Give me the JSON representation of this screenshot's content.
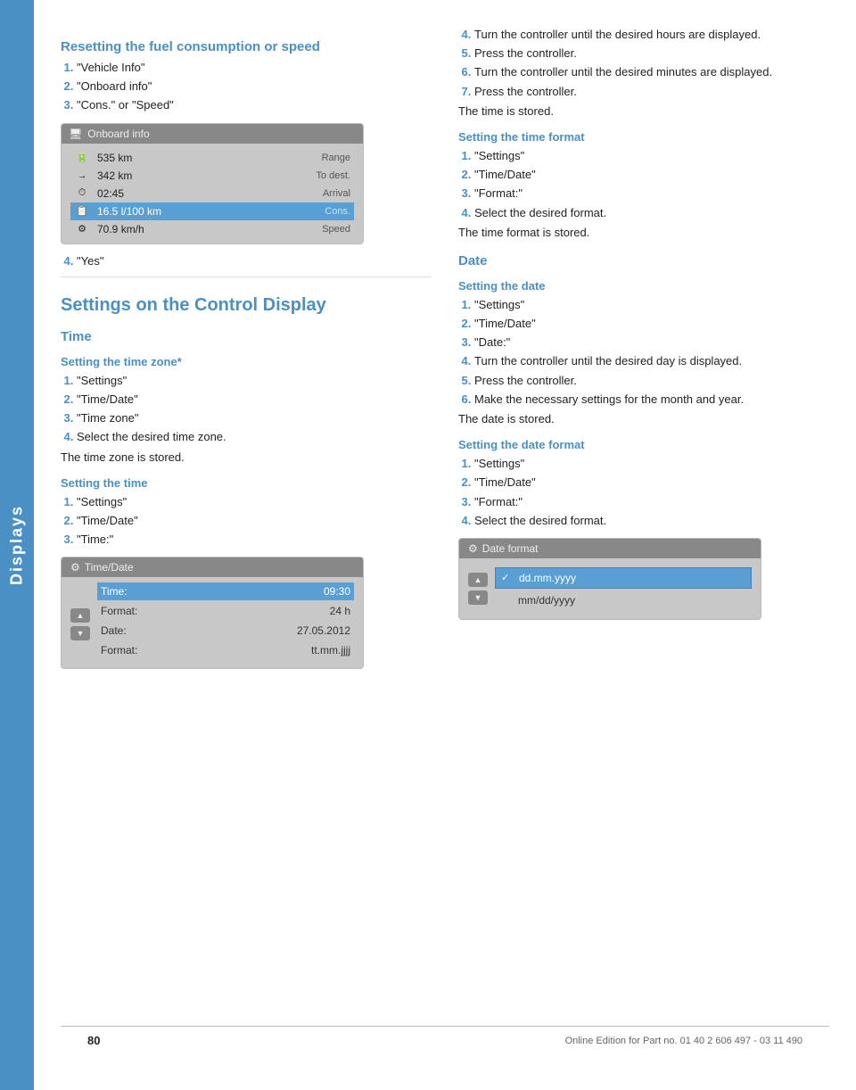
{
  "side_tab": {
    "label": "Displays"
  },
  "left_col": {
    "top_section": {
      "heading": "Resetting the fuel consumption or speed",
      "steps": [
        "\"Vehicle Info\"",
        "\"Onboard info\"",
        "\"Cons.\" or \"Speed\""
      ],
      "screen1": {
        "header": "Onboard info",
        "rows": [
          {
            "icon": "🔋",
            "label": "535 km",
            "unit": "Range",
            "highlighted": false
          },
          {
            "icon": "➡",
            "label": "342 km",
            "unit": "To dest.",
            "highlighted": false
          },
          {
            "icon": "⏱",
            "label": "02:45",
            "unit": "Arrival",
            "highlighted": false
          },
          {
            "icon": "📋",
            "label": "16.5 l/100 km",
            "unit": "Cons.",
            "highlighted": true
          },
          {
            "icon": "⚙",
            "label": "70.9 km/h",
            "unit": "Speed",
            "highlighted": false
          }
        ]
      },
      "step4": "\"Yes\""
    },
    "main_section": {
      "heading": "Settings on the Control Display",
      "time_section": {
        "label": "Time",
        "timezone_sub": {
          "heading": "Setting the time zone*",
          "steps": [
            "\"Settings\"",
            "\"Time/Date\"",
            "\"Time zone\"",
            "Select the desired time zone."
          ],
          "note": "The time zone is stored."
        },
        "set_time_sub": {
          "heading": "Setting the time",
          "steps": [
            "\"Settings\"",
            "\"Time/Date\"",
            "\"Time:\""
          ],
          "screen2": {
            "header": "Time/Date",
            "rows": [
              {
                "label": "Time:",
                "value": "09:30",
                "highlighted": true
              },
              {
                "label": "Format:",
                "value": "24 h",
                "highlighted": false
              },
              {
                "label": "Date:",
                "value": "27.05.2012",
                "highlighted": false
              },
              {
                "label": "Format:",
                "value": "tt.mm.jjjj",
                "highlighted": false
              }
            ]
          }
        }
      }
    }
  },
  "right_col": {
    "time_continued": {
      "steps_extra": [
        "Turn the controller until the desired hours are displayed.",
        "Press the controller.",
        "Turn the controller until the desired minutes are displayed.",
        "Press the controller."
      ],
      "note": "The time is stored.",
      "time_format_sub": {
        "heading": "Setting the time format",
        "steps": [
          "\"Settings\"",
          "\"Time/Date\"",
          "\"Format:\"",
          "Select the desired format."
        ],
        "note": "The time format is stored."
      }
    },
    "date_section": {
      "label": "Date",
      "set_date_sub": {
        "heading": "Setting the date",
        "steps": [
          "\"Settings\"",
          "\"Time/Date\"",
          "\"Date:\"",
          "Turn the controller until the desired day is displayed.",
          "Press the controller.",
          "Make the necessary settings for the month and year."
        ],
        "note": "The date is stored."
      },
      "date_format_sub": {
        "heading": "Setting the date format",
        "steps": [
          "\"Settings\"",
          "\"Time/Date\"",
          "\"Format:\"",
          "Select the desired format."
        ],
        "screen3": {
          "header": "Date format",
          "rows": [
            {
              "label": "dd.mm.yyyy",
              "checked": true,
              "highlighted": true
            },
            {
              "label": "mm/dd/yyyy",
              "checked": false,
              "highlighted": false
            }
          ]
        }
      }
    }
  },
  "footer": {
    "page_number": "80",
    "footer_text": "Online Edition for Part no. 01 40 2 606 497 - 03 11 490"
  },
  "icons": {
    "gear": "⚙",
    "check": "✓",
    "arrow_left": "◄",
    "arrow_right": "►"
  }
}
